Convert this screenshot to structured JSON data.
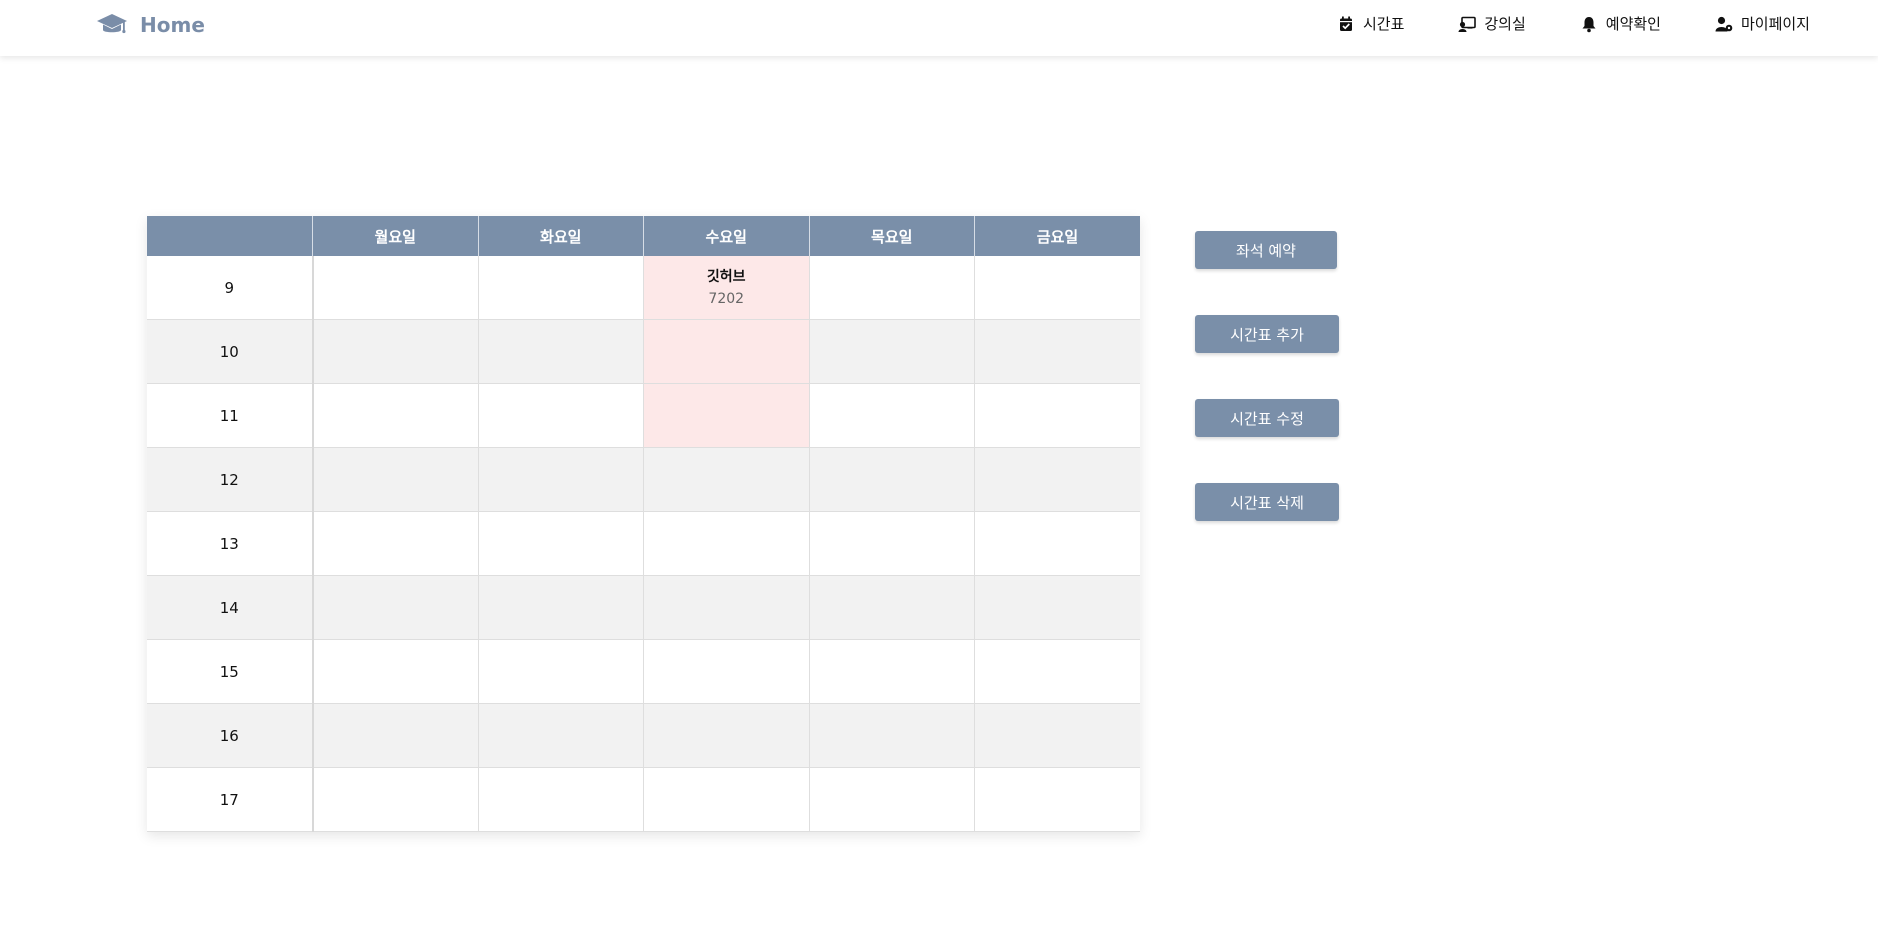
{
  "header": {
    "brand_label": "Home",
    "brand_icon": "graduation-cap-icon",
    "nav_items": [
      {
        "label": "시간표",
        "icon": "calendar-check-icon"
      },
      {
        "label": "강의실",
        "icon": "chalkboard-teacher-icon"
      },
      {
        "label": "예약확인",
        "icon": "bell-icon"
      },
      {
        "label": "마이페이지",
        "icon": "user-cog-icon"
      }
    ]
  },
  "timetable": {
    "corner": "",
    "days": [
      "월요일",
      "화요일",
      "수요일",
      "목요일",
      "금요일"
    ],
    "hours": [
      "9",
      "10",
      "11",
      "12",
      "13",
      "14",
      "15",
      "16",
      "17"
    ],
    "course": {
      "name": "깃허브",
      "room": "7202",
      "day": "수요일",
      "start_hour": "9",
      "end_hour": "11"
    }
  },
  "side_buttons": {
    "reserve_seat": "좌석 예약",
    "add_timetable": "시간표 추가",
    "edit_timetable": "시간표 수정",
    "delete_timetable": "시간표 삭제"
  },
  "colors": {
    "accent": "#7a8fa9",
    "brand_text": "#7a8da8",
    "occupied": "#fde8e8",
    "row_alt": "#f2f2f2"
  }
}
